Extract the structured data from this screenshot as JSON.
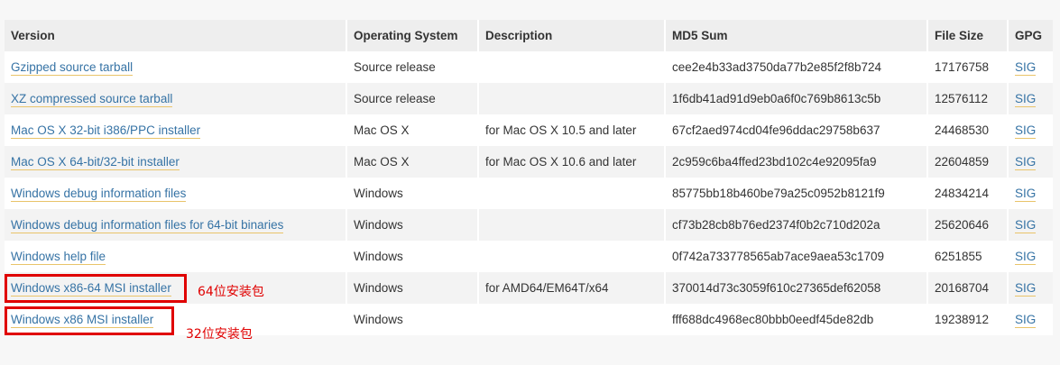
{
  "headers": [
    "Version",
    "Operating System",
    "Description",
    "MD5 Sum",
    "File Size",
    "GPG"
  ],
  "rows": [
    {
      "version": "Gzipped source tarball",
      "os": "Source release",
      "desc": "",
      "md5": "cee2e4b33ad3750da77b2e85f2f8b724",
      "size": "17176758",
      "gpg": "SIG"
    },
    {
      "version": "XZ compressed source tarball",
      "os": "Source release",
      "desc": "",
      "md5": "1f6db41ad91d9eb0a6f0c769b8613c5b",
      "size": "12576112",
      "gpg": "SIG"
    },
    {
      "version": "Mac OS X 32-bit i386/PPC installer",
      "os": "Mac OS X",
      "desc": "for Mac OS X 10.5 and later",
      "md5": "67cf2aed974cd04fe96ddac29758b637",
      "size": "24468530",
      "gpg": "SIG"
    },
    {
      "version": "Mac OS X 64-bit/32-bit installer",
      "os": "Mac OS X",
      "desc": "for Mac OS X 10.6 and later",
      "md5": "2c959c6ba4ffed23bd102c4e92095fa9",
      "size": "22604859",
      "gpg": "SIG"
    },
    {
      "version": "Windows debug information files",
      "os": "Windows",
      "desc": "",
      "md5": "85775bb18b460be79a25c0952b8121f9",
      "size": "24834214",
      "gpg": "SIG"
    },
    {
      "version": "Windows debug information files for 64-bit binaries",
      "os": "Windows",
      "desc": "",
      "md5": "cf73b28cb8b76ed2374f0b2c710d202a",
      "size": "25620646",
      "gpg": "SIG"
    },
    {
      "version": "Windows help file",
      "os": "Windows",
      "desc": "",
      "md5": "0f742a733778565ab7ace9aea53c1709",
      "size": "6251855",
      "gpg": "SIG"
    },
    {
      "version": "Windows x86-64 MSI installer",
      "os": "Windows",
      "desc": "for AMD64/EM64T/x64",
      "md5": "370014d73c3059f610c27365def62058",
      "size": "20168704",
      "gpg": "SIG"
    },
    {
      "version": "Windows x86 MSI installer",
      "os": "Windows",
      "desc": "",
      "md5": "fff688dc4968ec80bbb0eedf45de82db",
      "size": "19238912",
      "gpg": "SIG"
    }
  ],
  "annotations": {
    "note_64": "64位安装包",
    "note_32": "32位安装包"
  },
  "colors": {
    "link": "#3673a5",
    "annotation": "#e00000"
  }
}
